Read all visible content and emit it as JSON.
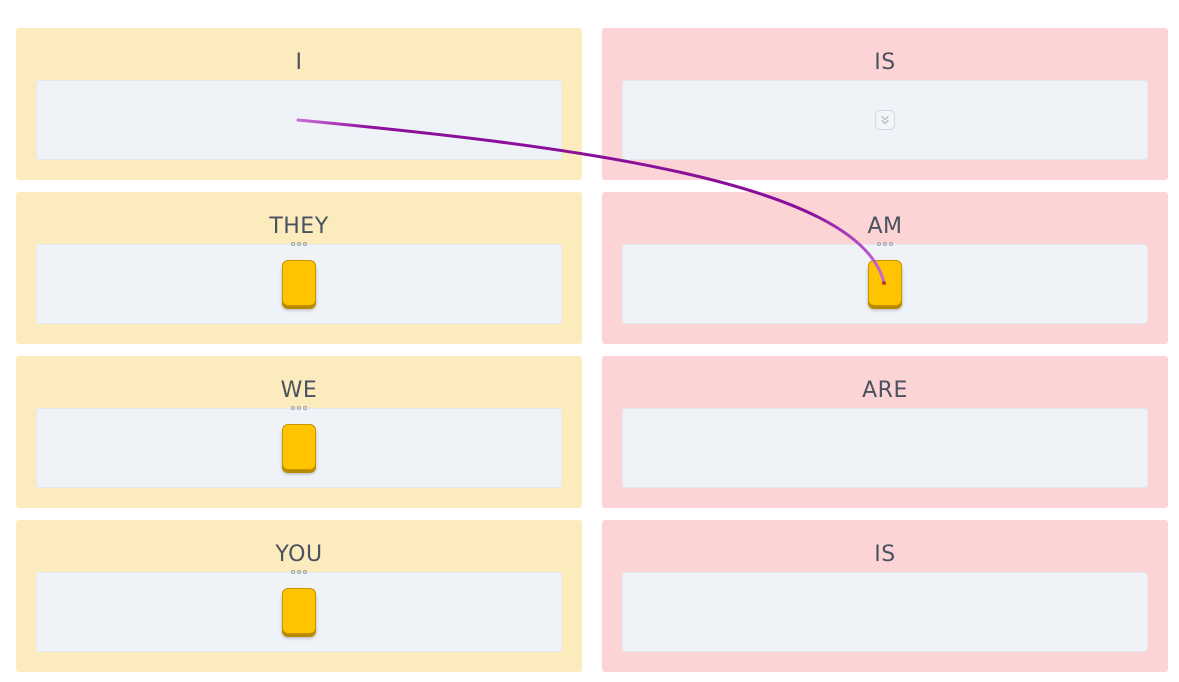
{
  "cards": {
    "left": [
      {
        "title": "I",
        "has_token": false
      },
      {
        "title": "THEY",
        "has_token": true
      },
      {
        "title": "WE",
        "has_token": true
      },
      {
        "title": "YOU",
        "has_token": true
      }
    ],
    "right": [
      {
        "title": "IS",
        "has_token": false
      },
      {
        "title": "AM",
        "has_token": true
      },
      {
        "title": "ARE",
        "has_token": false
      },
      {
        "title": "IS",
        "has_token": false
      }
    ]
  },
  "icons": {
    "drag_handle": "drag-handle-icon",
    "expand": "chevron-double-down-icon"
  },
  "colors": {
    "left_card_bg": "#fcebbd",
    "right_card_bg": "#fdd4d6",
    "dropzone_bg": "#eff2f7",
    "token": "#ffc400",
    "connector_start": "#c86dd7",
    "connector_end": "#8b0f9a",
    "title_text": "#4a5260"
  }
}
